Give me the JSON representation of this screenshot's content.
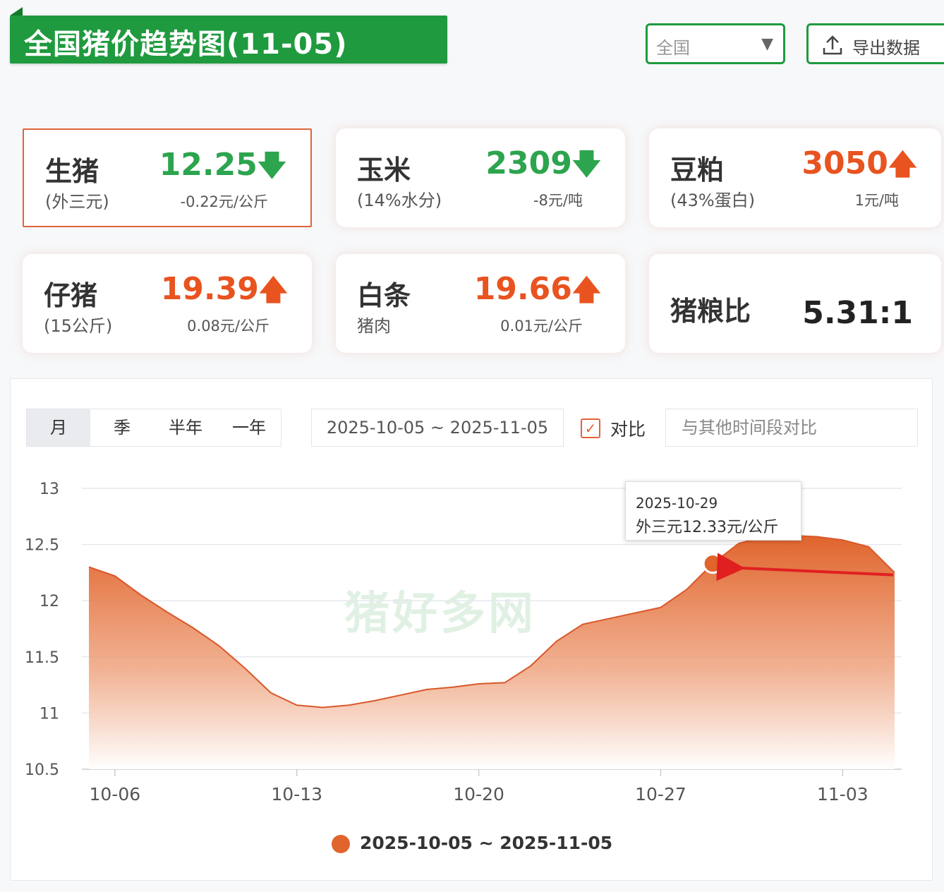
{
  "header": {
    "title": "全国猪价趋势图(11-05)",
    "region": "全国",
    "export_label": "导出数据"
  },
  "cards": [
    {
      "name": "生猪",
      "sub": "(外三元)",
      "value": "12.25",
      "arrow": "down",
      "change": "-0.22元/公斤",
      "active": true
    },
    {
      "name": "玉米",
      "sub": "(14%水分)",
      "value": "2309",
      "arrow": "down",
      "change": "-8元/吨"
    },
    {
      "name": "豆粕",
      "sub": "(43%蛋白)",
      "value": "3050",
      "arrow": "up",
      "change": "1元/吨"
    },
    {
      "name": "仔猪",
      "sub": "(15公斤)",
      "value": "19.39",
      "arrow": "up",
      "change": "0.08元/公斤"
    },
    {
      "name": "白条",
      "sub": "猪肉",
      "value": "19.66",
      "arrow": "up",
      "change": "0.01元/公斤"
    },
    {
      "name": "猪粮比",
      "sub": "",
      "value": "5.31:1",
      "arrow": "none",
      "change": ""
    }
  ],
  "controls": {
    "period_tabs": [
      "月",
      "季",
      "半年",
      "一年"
    ],
    "selected_tab": "月",
    "date_range": "2025-10-05 ~ 2025-11-05",
    "compare_checked": "✓",
    "compare_label": "对比",
    "compare_placeholder": "与其他时间段对比"
  },
  "tooltip": {
    "date": "2025-10-29",
    "text": "外三元12.33元/公斤"
  },
  "watermark": "猪好多网",
  "colors": {
    "brand_green": "#1f9a3e",
    "down_green": "#2da44e",
    "up_red": "#e8531f",
    "area_fill": "#e0642c",
    "annotation_arrow": "#e02020"
  },
  "chart_data": {
    "type": "area",
    "ylim": [
      10.5,
      13
    ],
    "y_ticks": [
      10.5,
      11,
      11.5,
      12,
      12.5,
      13
    ],
    "x_tick_labels": [
      "10-06",
      "10-13",
      "10-20",
      "10-27",
      "11-03"
    ],
    "x_ticks_index": [
      1,
      8,
      15,
      22,
      29
    ],
    "grid": true,
    "legend_position": "bottom-center",
    "series": [
      {
        "name": "2025-10-05 ~ 2025-11-05",
        "x": [
          "10-05",
          "10-06",
          "10-07",
          "10-08",
          "10-09",
          "10-10",
          "10-11",
          "10-12",
          "10-13",
          "10-14",
          "10-15",
          "10-16",
          "10-17",
          "10-18",
          "10-19",
          "10-20",
          "10-21",
          "10-22",
          "10-23",
          "10-24",
          "10-25",
          "10-26",
          "10-27",
          "10-28",
          "10-29",
          "10-30",
          "10-31",
          "11-01",
          "11-02",
          "11-03",
          "11-04",
          "11-05"
        ],
        "values": [
          12.3,
          12.22,
          12.05,
          11.9,
          11.76,
          11.6,
          11.4,
          11.18,
          11.07,
          11.05,
          11.07,
          11.11,
          11.16,
          11.21,
          11.23,
          11.26,
          11.27,
          11.42,
          11.64,
          11.79,
          11.84,
          11.89,
          11.94,
          12.1,
          12.33,
          12.51,
          12.57,
          12.58,
          12.57,
          12.54,
          12.48,
          12.25
        ]
      }
    ],
    "highlight_point": {
      "x": "10-29",
      "value": 12.33
    }
  }
}
